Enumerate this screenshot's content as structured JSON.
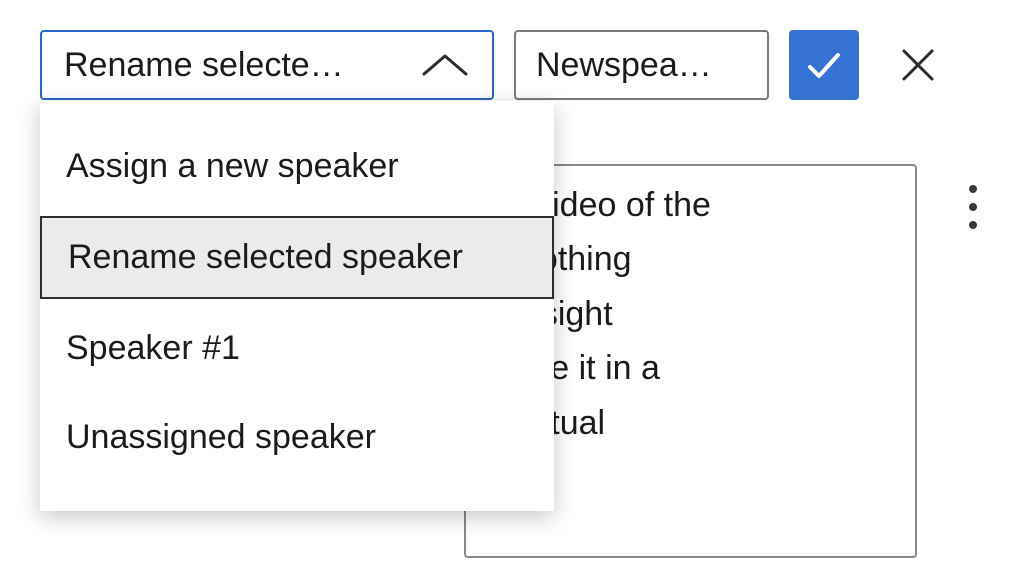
{
  "toolbar": {
    "select_display": "Rename selecte…",
    "input_value": "Newspea…"
  },
  "dropdown": {
    "items": [
      {
        "label": "Assign a new speaker",
        "selected": false
      },
      {
        "label": "Rename selected speaker",
        "selected": true
      },
      {
        "label": "Speaker #1",
        "selected": false
      },
      {
        "label": "Unassigned speaker",
        "selected": false
      }
    ]
  },
  "transcript": {
    "lines": [
      "ort video of the",
      "d clothing",
      "e insight",
      "d use it in a",
      "ntextual"
    ]
  }
}
